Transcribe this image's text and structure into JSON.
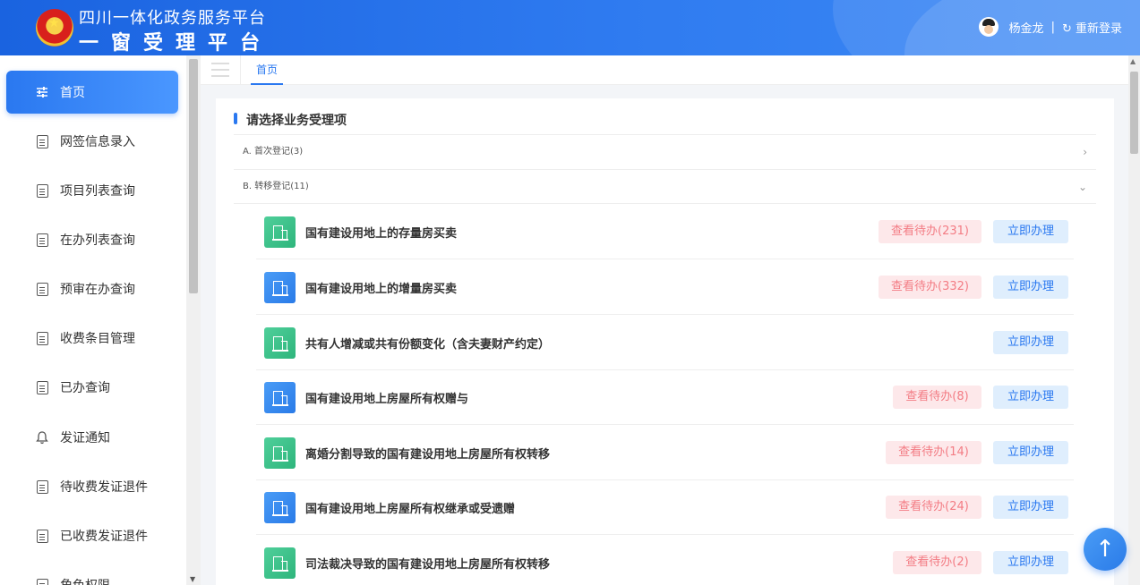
{
  "header": {
    "title_line1": "四川一体化政务服务平台",
    "title_line2": "一窗受理平台",
    "username": "杨金龙",
    "separator": "|",
    "relogin_label": "重新登录",
    "brand_color": "#2a78f0"
  },
  "sidebar": {
    "items": [
      {
        "label": "首页",
        "icon": "sliders-icon",
        "active": true
      },
      {
        "label": "网签信息录入",
        "icon": "document-icon"
      },
      {
        "label": "项目列表查询",
        "icon": "document-icon"
      },
      {
        "label": "在办列表查询",
        "icon": "document-icon"
      },
      {
        "label": "预审在办查询",
        "icon": "document-icon"
      },
      {
        "label": "收费条目管理",
        "icon": "document-icon"
      },
      {
        "label": "已办查询",
        "icon": "document-search-icon"
      },
      {
        "label": "发证通知",
        "icon": "bell-icon"
      },
      {
        "label": "待收费发证退件",
        "icon": "document-icon"
      },
      {
        "label": "已收费发证退件",
        "icon": "document-icon"
      },
      {
        "label": "角色权限",
        "icon": "document-icon"
      }
    ]
  },
  "tabs": [
    {
      "label": "首页"
    }
  ],
  "panel": {
    "title": "请选择业务受理项",
    "categories": [
      {
        "label": "A. 首次登记(3)",
        "expanded": false
      },
      {
        "label": "B. 转移登记(11)",
        "expanded": true
      }
    ],
    "items": [
      {
        "name": "国有建设用地上的存量房买卖",
        "todo": "查看待办(231)",
        "go": "立即办理",
        "icon_color": "green"
      },
      {
        "name": "国有建设用地上的增量房买卖",
        "todo": "查看待办(332)",
        "go": "立即办理",
        "icon_color": "blue"
      },
      {
        "name": "共有人增减或共有份额变化（含夫妻财产约定）",
        "todo": null,
        "go": "立即办理",
        "icon_color": "green"
      },
      {
        "name": "国有建设用地上房屋所有权赠与",
        "todo": "查看待办(8)",
        "go": "立即办理",
        "icon_color": "blue"
      },
      {
        "name": "离婚分割导致的国有建设用地上房屋所有权转移",
        "todo": "查看待办(14)",
        "go": "立即办理",
        "icon_color": "green"
      },
      {
        "name": "国有建设用地上房屋所有权继承或受遗赠",
        "todo": "查看待办(24)",
        "go": "立即办理",
        "icon_color": "blue"
      },
      {
        "name": "司法裁决导致的国有建设用地上房屋所有权转移",
        "todo": "查看待办(2)",
        "go": "立即办理",
        "icon_color": "green"
      }
    ]
  }
}
